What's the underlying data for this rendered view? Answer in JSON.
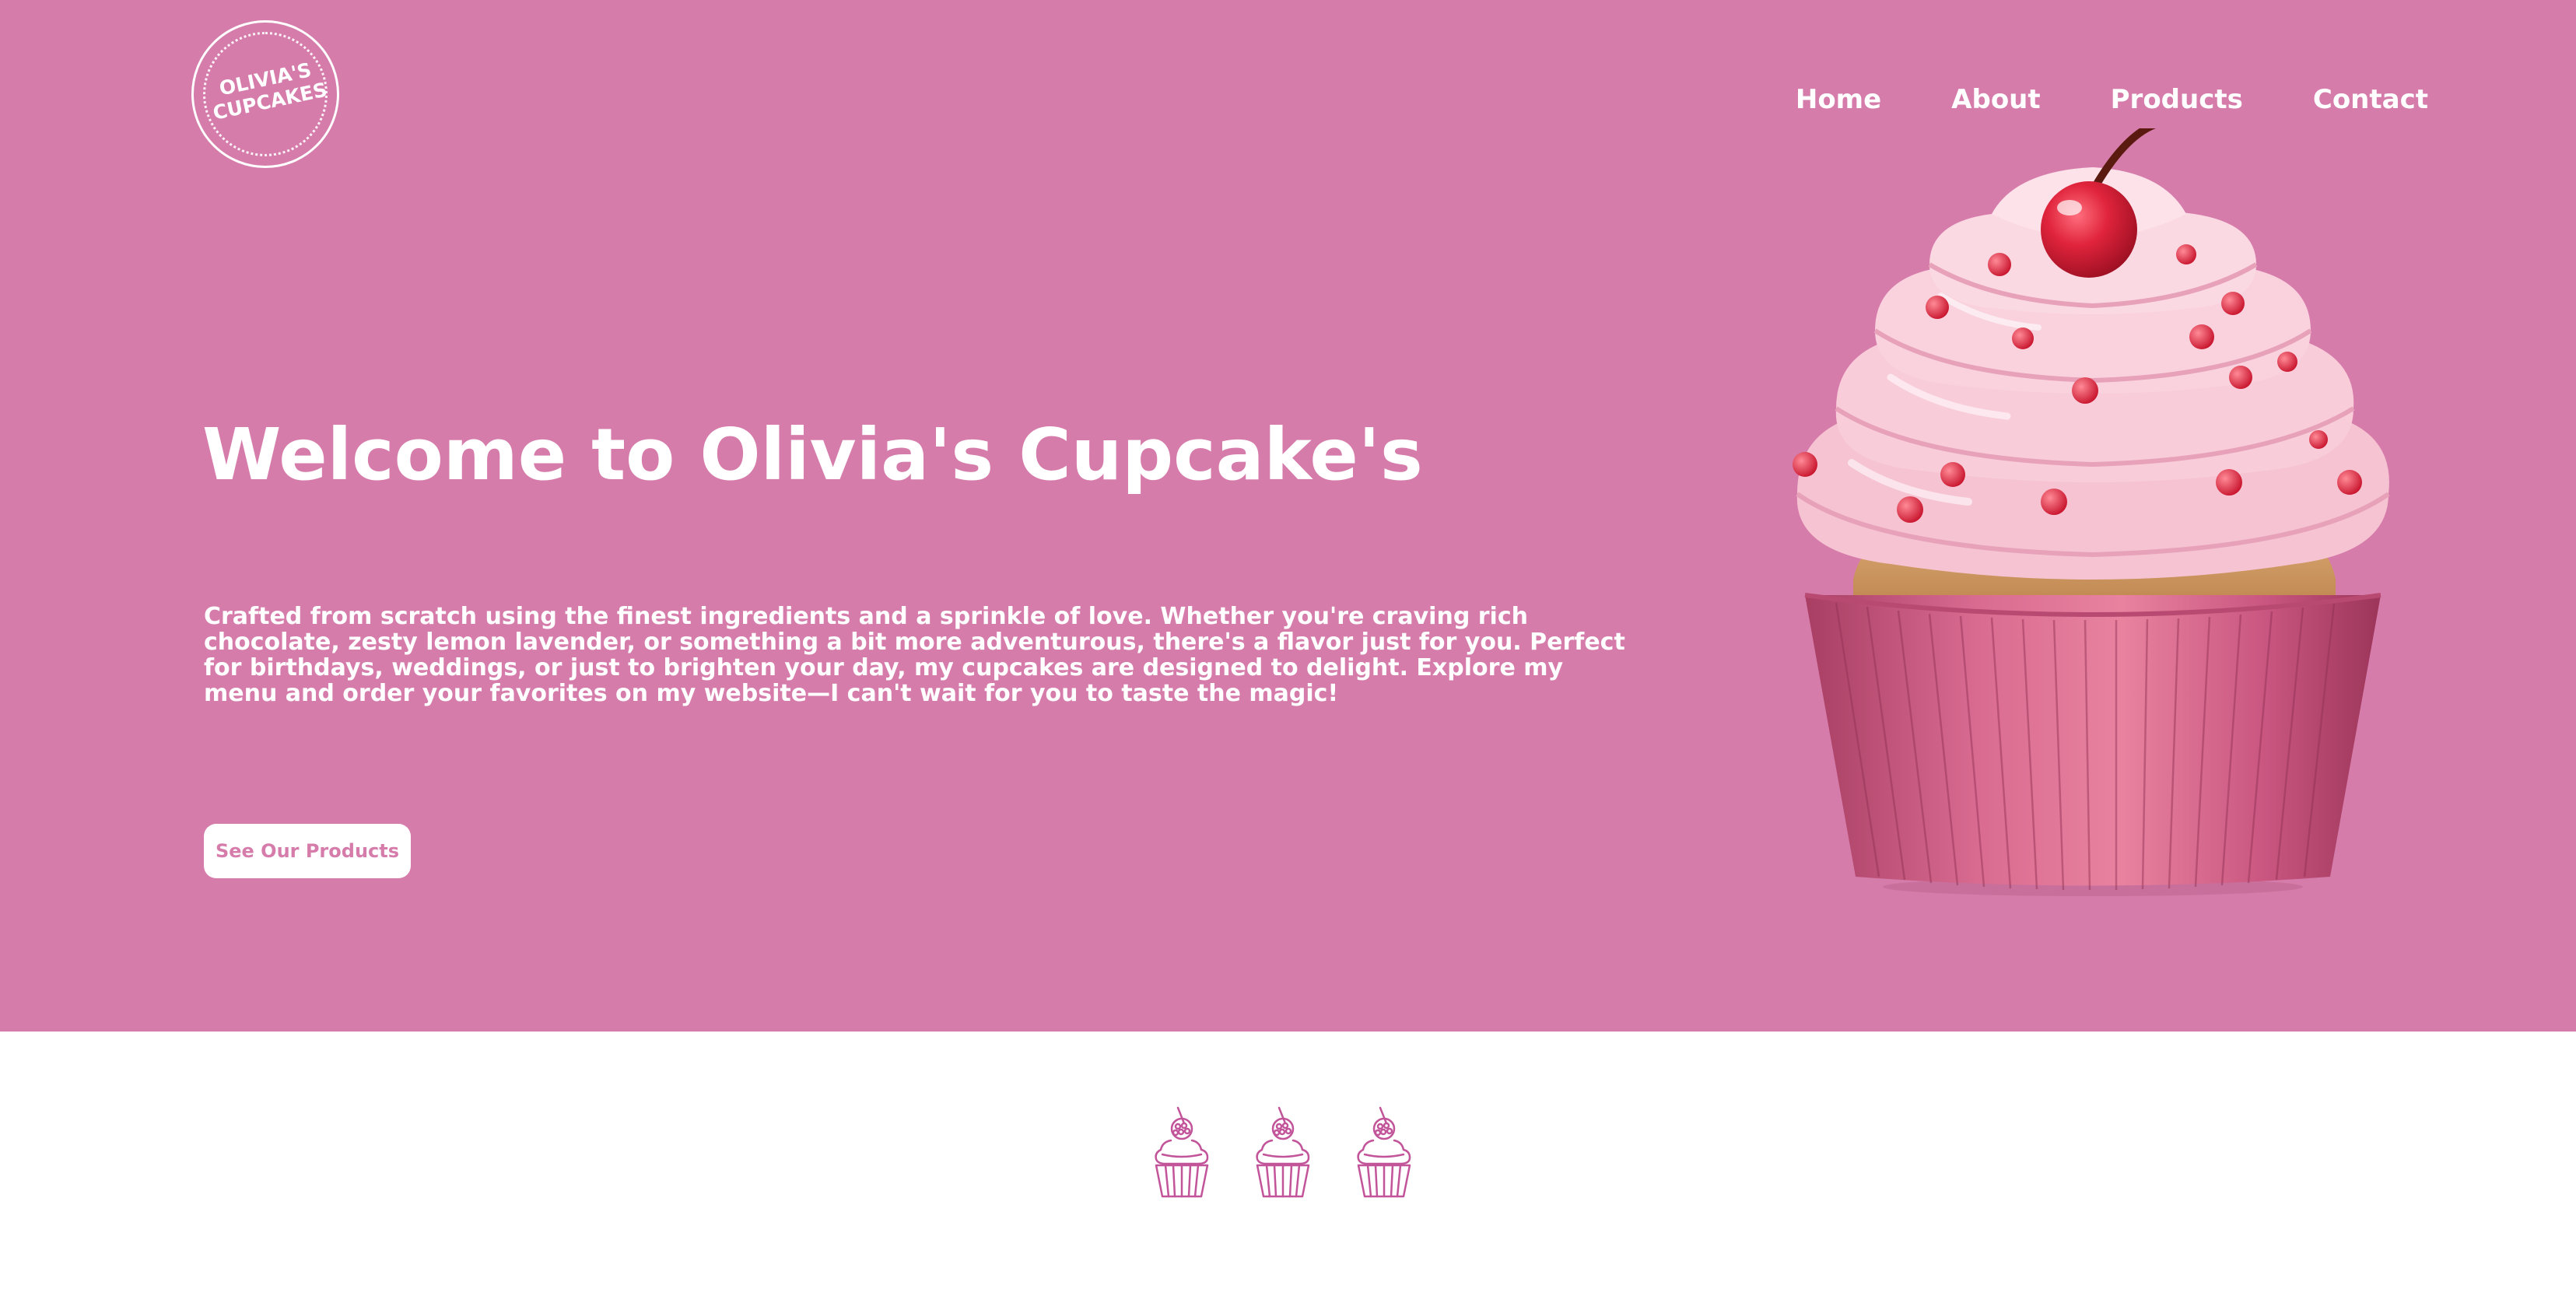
{
  "brand": {
    "logo_line1": "OLIVIA'S",
    "logo_line2": "CUPCAKES"
  },
  "nav": {
    "items": [
      "Home",
      "About",
      "Products",
      "Contact"
    ]
  },
  "hero": {
    "title": "Welcome to Olivia's Cupcake's",
    "description": "Crafted from scratch using the finest ingredients and a sprinkle of love. Whether you're craving rich chocolate, zesty lemon lavender, or something a bit more adventurous, there's a flavor just for you. Perfect for birthdays, weddings, or just to brighten your day, my cupcakes are designed to delight. Explore my menu and order your favorites on my website—I can't wait for you to taste the magic!",
    "cta_label": "See Our Products",
    "image_icon": "cherry-cupcake-illustration"
  },
  "decor_icons": [
    "cupcake-outline-icon",
    "cupcake-outline-icon",
    "cupcake-outline-icon"
  ],
  "colors": {
    "brand_pink": "#d67cab",
    "background": "#ffffff",
    "text_on_brand": "#ffffff",
    "icon_outline": "#c2549a"
  }
}
